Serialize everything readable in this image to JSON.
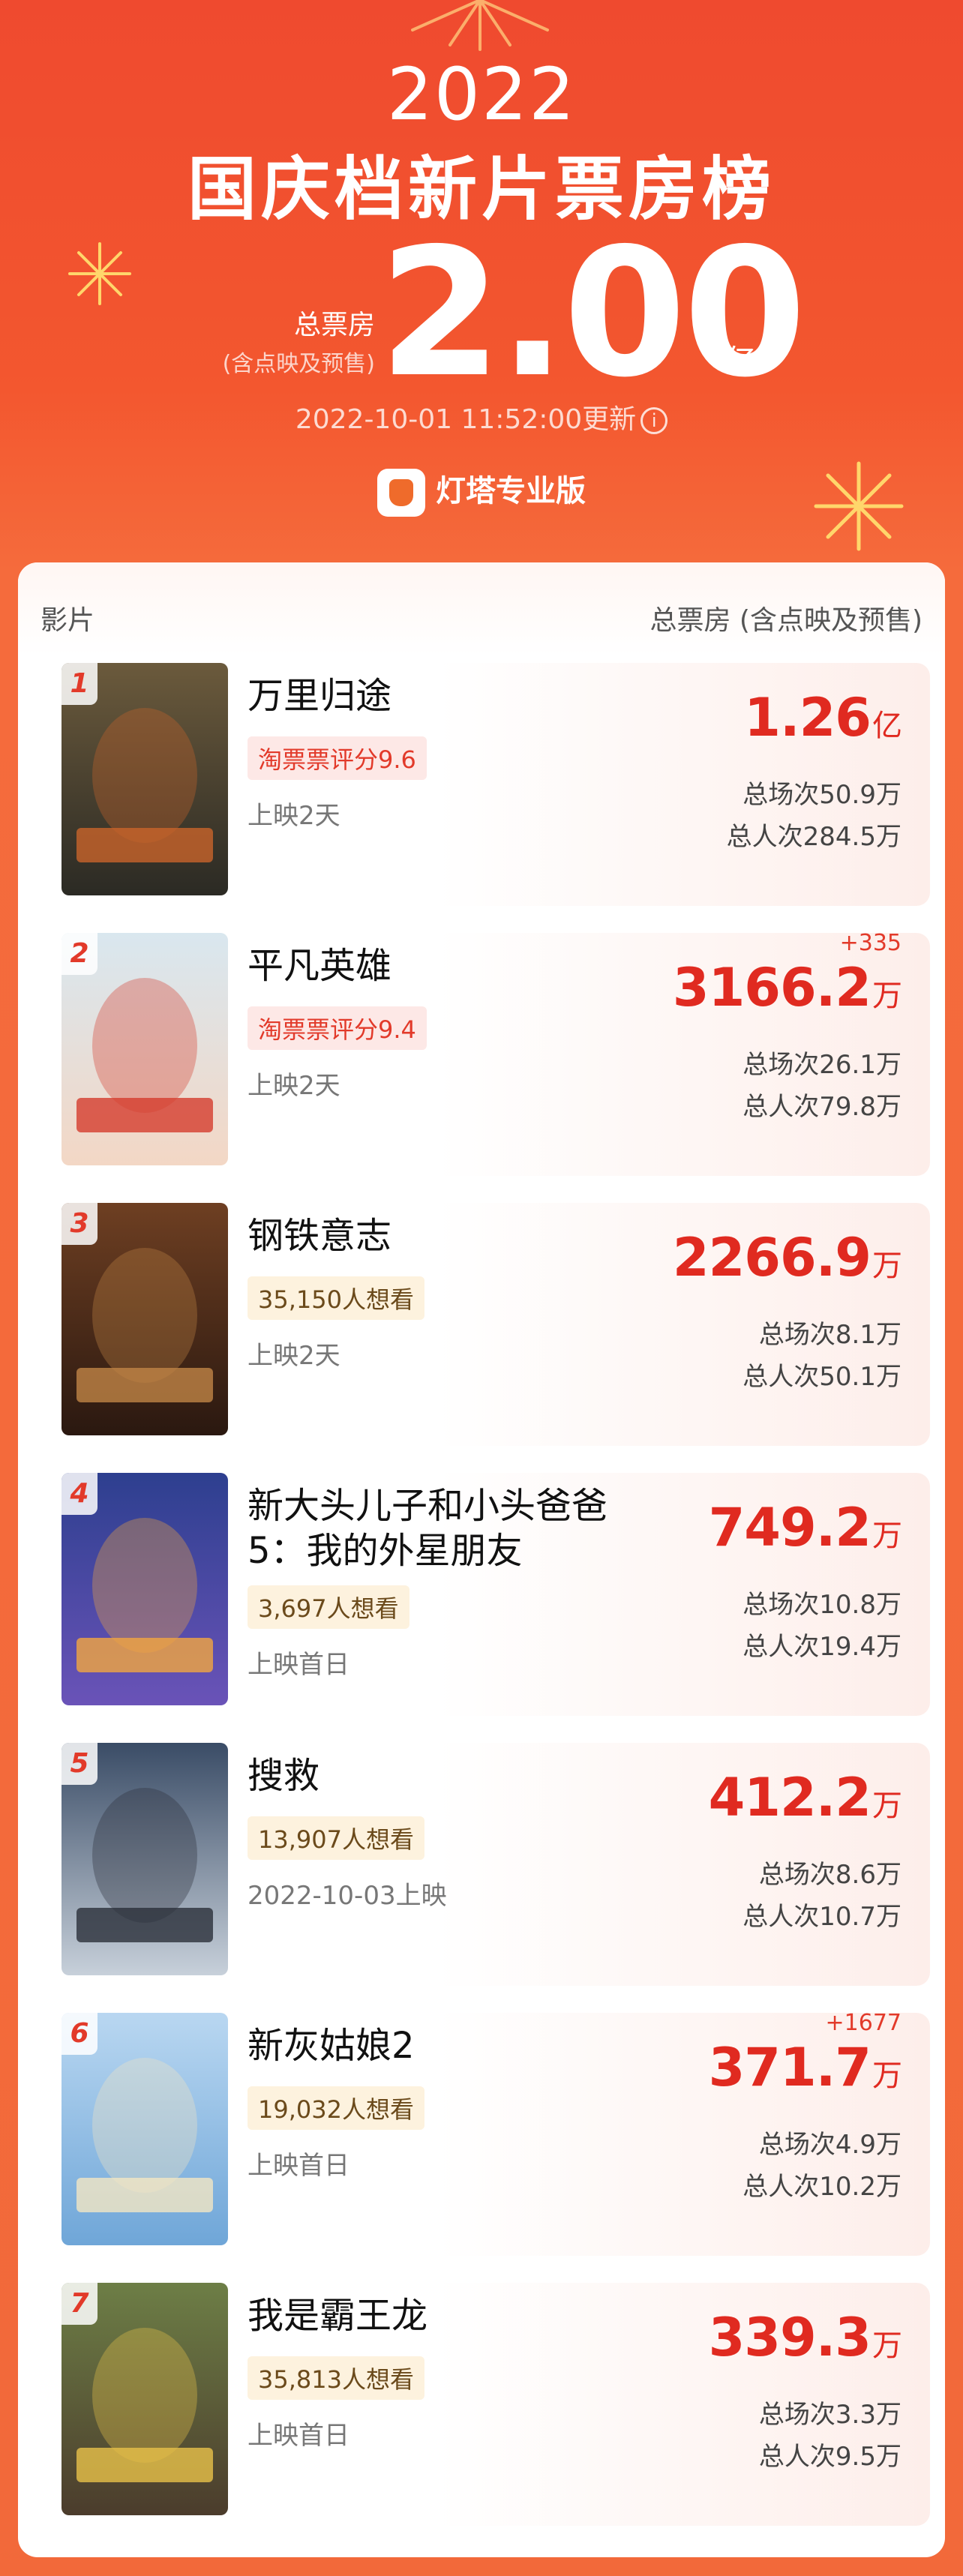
{
  "header": {
    "year": "2022",
    "title": "国庆档新片票房榜",
    "total_label": "总票房",
    "total_sub": "(含点映及预售)",
    "total_value": "2.00",
    "total_unit": "亿",
    "update_text": "2022-10-01 11:52:00更新",
    "info_glyph": "i",
    "brand": "灯塔专业版"
  },
  "table": {
    "col_film": "影片",
    "col_box": "总票房 (含点映及预售)"
  },
  "films": [
    {
      "rank": "1",
      "name": "万里归途",
      "tag": "淘票票评分9.6",
      "tag_type": "rating",
      "status": "上映2天",
      "delta": "",
      "box_value": "1.26",
      "box_unit": "亿",
      "shows": "总场次50.9万",
      "viewers": "总人次284.5万"
    },
    {
      "rank": "2",
      "name": "平凡英雄",
      "tag": "淘票票评分9.4",
      "tag_type": "rating",
      "status": "上映2天",
      "delta": "+335",
      "box_value": "3166.2",
      "box_unit": "万",
      "shows": "总场次26.1万",
      "viewers": "总人次79.8万"
    },
    {
      "rank": "3",
      "name": "钢铁意志",
      "tag": "35,150人想看",
      "tag_type": "want",
      "status": "上映2天",
      "delta": "",
      "box_value": "2266.9",
      "box_unit": "万",
      "shows": "总场次8.1万",
      "viewers": "总人次50.1万"
    },
    {
      "rank": "4",
      "name": "新大头儿子和小头爸爸5：我的外星朋友",
      "tag": "3,697人想看",
      "tag_type": "want",
      "status": "上映首日",
      "delta": "",
      "box_value": "749.2",
      "box_unit": "万",
      "shows": "总场次10.8万",
      "viewers": "总人次19.4万"
    },
    {
      "rank": "5",
      "name": "搜救",
      "tag": "13,907人想看",
      "tag_type": "want",
      "status": "2022-10-03上映",
      "delta": "",
      "box_value": "412.2",
      "box_unit": "万",
      "shows": "总场次8.6万",
      "viewers": "总人次10.7万"
    },
    {
      "rank": "6",
      "name": "新灰姑娘2",
      "tag": "19,032人想看",
      "tag_type": "want",
      "status": "上映首日",
      "delta": "+1677",
      "box_value": "371.7",
      "box_unit": "万",
      "shows": "总场次4.9万",
      "viewers": "总人次10.2万"
    },
    {
      "rank": "7",
      "name": "我是霸王龙",
      "tag": "35,813人想看",
      "tag_type": "want",
      "status": "上映首日",
      "delta": "",
      "box_value": "339.3",
      "box_unit": "万",
      "shows": "总场次3.3万",
      "viewers": "总人次9.5万"
    }
  ],
  "posters": [
    {
      "c1": "#6b5a3c",
      "c2": "#2b2a24",
      "c3": "#c9642a"
    },
    {
      "c1": "#d9e7ef",
      "c2": "#f3d7c5",
      "c3": "#d43c2d"
    },
    {
      "c1": "#6e3f22",
      "c2": "#2a1810",
      "c3": "#c08546"
    },
    {
      "c1": "#2d3f8f",
      "c2": "#6a53b8",
      "c3": "#f2a640"
    },
    {
      "c1": "#3a4c66",
      "c2": "#c7d0da",
      "c3": "#2a2f3a"
    },
    {
      "c1": "#b9d7f1",
      "c2": "#6fa6d8",
      "c3": "#f3e6c3"
    },
    {
      "c1": "#6d7e46",
      "c2": "#4b3c2c",
      "c3": "#e8c24a"
    }
  ],
  "colors": {
    "accent": "#e02a20",
    "header": "#ef4a2f"
  }
}
